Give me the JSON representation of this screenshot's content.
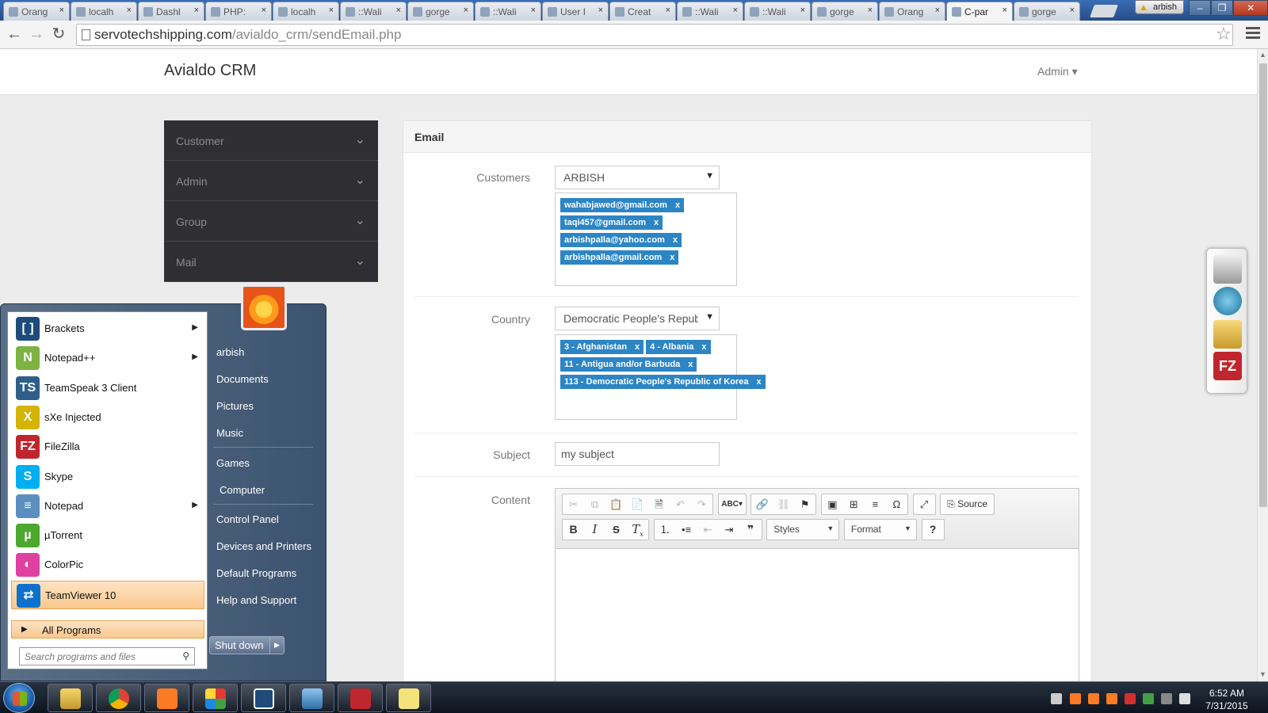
{
  "browser": {
    "tabs": [
      "Orang",
      "localh",
      "Dashl",
      "PHP:",
      "localh",
      "::Wali",
      "gorge",
      "::Wali",
      "User I",
      "Creat",
      "::Wali",
      "::Wali",
      "gorge",
      "Orang",
      "C-par",
      "gorge"
    ],
    "active_tab_index": 14,
    "user": "arbish",
    "url_host": "servotechshipping.com",
    "url_path": "/avialdo_crm/sendEmail.php",
    "close_glyph": "×"
  },
  "app": {
    "brand": "Avialdo CRM",
    "admin_menu": "Admin ▾"
  },
  "sidebar": {
    "items": [
      {
        "label": "Customer"
      },
      {
        "label": "Admin"
      },
      {
        "label": "Group"
      },
      {
        "label": "Mail"
      }
    ]
  },
  "email": {
    "panel_title": "Email",
    "customers_label": "Customers",
    "customers_selected": "ARBISH",
    "customer_tags": [
      "wahabjawed@gmail.com",
      "taqi457@gmail.com",
      "arbishpalla@yahoo.com",
      "arbishpalla@gmail.com"
    ],
    "country_label": "Country",
    "country_selected": "Democratic People's Republic of Korea",
    "country_tags": [
      "3 - Afghanistan",
      "4 - Albania",
      "11 - Antigua and/or Barbuda",
      "113 - Democratic People's Republic of Korea"
    ],
    "subject_label": "Subject",
    "subject_value": "my subject",
    "content_label": "Content",
    "tag_remove": "x"
  },
  "editor": {
    "source_label": "Source",
    "styles_label": "Styles",
    "format_label": "Format",
    "help_label": "?"
  },
  "start_menu": {
    "programs": [
      {
        "name": "Brackets",
        "submenu": true,
        "color": "#1e4b7a",
        "glyph": "[ ]"
      },
      {
        "name": "Notepad++",
        "submenu": true,
        "color": "#7cb342",
        "glyph": "N"
      },
      {
        "name": "TeamSpeak 3 Client",
        "submenu": false,
        "color": "#2e5f8a",
        "glyph": "TS"
      },
      {
        "name": "sXe Injected",
        "submenu": false,
        "color": "#d4b400",
        "glyph": "X"
      },
      {
        "name": "FileZilla",
        "submenu": false,
        "color": "#c0262d",
        "glyph": "FZ"
      },
      {
        "name": "Skype",
        "submenu": false,
        "color": "#00aff0",
        "glyph": "S"
      },
      {
        "name": "Notepad",
        "submenu": true,
        "color": "#5c8fbf",
        "glyph": "≡"
      },
      {
        "name": "µTorrent",
        "submenu": false,
        "color": "#4ca82e",
        "glyph": "µ"
      },
      {
        "name": "ColorPic",
        "submenu": false,
        "color": "#e040a0",
        "glyph": "◐"
      },
      {
        "name": "TeamViewer 10",
        "submenu": false,
        "color": "#0e72cc",
        "glyph": "⇄"
      }
    ],
    "all_programs": "All Programs",
    "search_placeholder": "Search programs and files",
    "right_items": [
      "arbish",
      "Documents",
      "Pictures",
      "Music",
      "Games",
      "Computer",
      "Control Panel",
      "Devices and Printers",
      "Default Programs",
      "Help and Support"
    ],
    "shutdown": "Shut down"
  },
  "taskbar": {
    "time": "6:52 AM",
    "date": "7/31/2015"
  }
}
